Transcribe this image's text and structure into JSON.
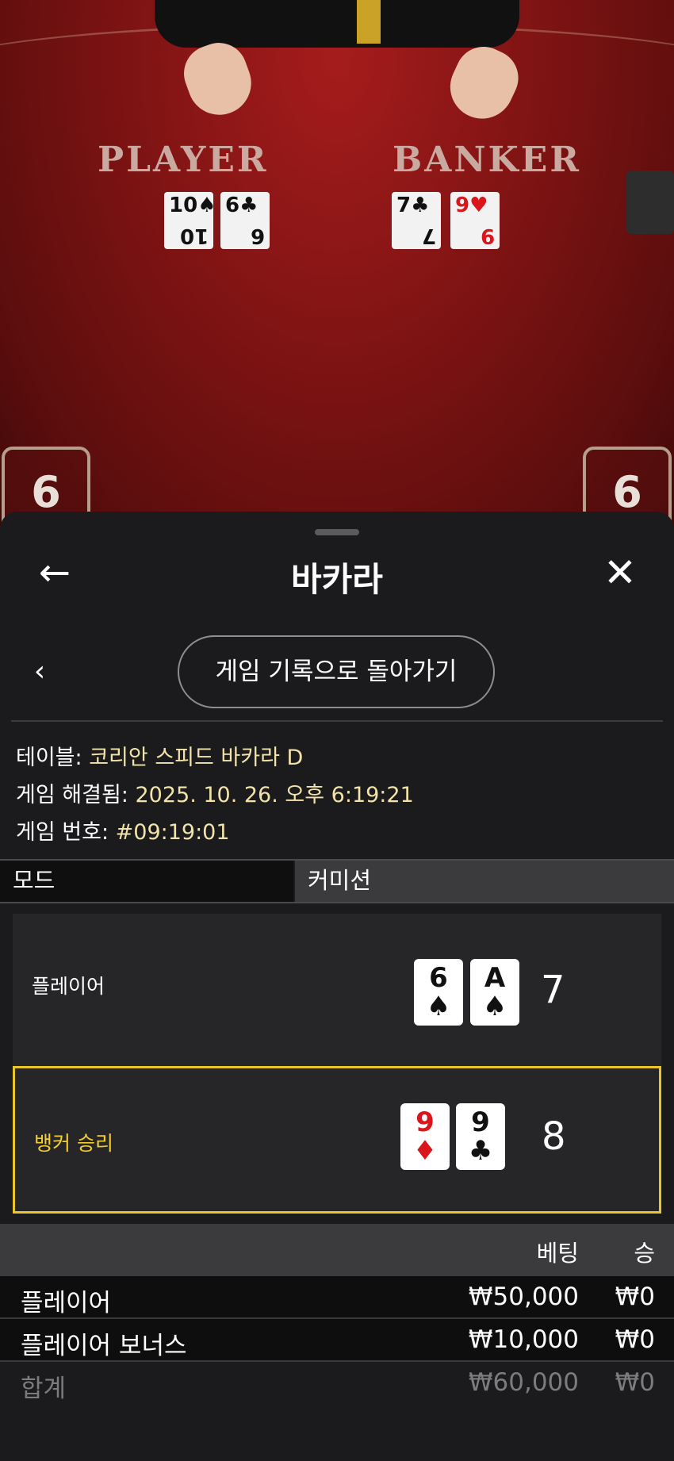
{
  "video": {
    "player_label": "PLAYER",
    "banker_label": "BANKER",
    "player_cards": [
      {
        "rank": "10",
        "suit": "♠",
        "color": "#111111"
      },
      {
        "rank": "6",
        "suit": "♣",
        "color": "#111111"
      }
    ],
    "banker_cards": [
      {
        "rank": "7",
        "suit": "♣",
        "color": "#111111"
      },
      {
        "rank": "9",
        "suit": "♥",
        "color": "#d8161b"
      }
    ],
    "player_score": "6",
    "banker_score": "6"
  },
  "header": {
    "back_icon": "←",
    "title": "바카라",
    "close_icon": "✕"
  },
  "nav": {
    "back_icon": "‹",
    "back_to_history": "게임 기록으로 돌아가기"
  },
  "info": {
    "table_label": "테이블:",
    "table_value": "코리안 스피드 바카라 D",
    "resolved_label": "게임 해결됨:",
    "resolved_value": "2025. 10. 26. 오후 6:19:21",
    "game_no_label": "게임 번호:",
    "game_no_value": "#09:19:01"
  },
  "tabs": {
    "mode": "모드",
    "commission": "커미션"
  },
  "result": {
    "player": {
      "label": "플레이어",
      "cards": [
        {
          "rank": "6",
          "suit": "♠"
        },
        {
          "rank": "A",
          "suit": "♠"
        }
      ],
      "total": "7"
    },
    "banker": {
      "label": "뱅커 승리",
      "cards": [
        {
          "rank": "9",
          "suit": "♦"
        },
        {
          "rank": "9",
          "suit": "♣"
        }
      ],
      "total": "8"
    },
    "highlight_color": "#e9c62a"
  },
  "bets": {
    "col_bet": "베팅",
    "col_win": "승",
    "rows": [
      {
        "name": "플레이어",
        "bet": "₩50,000",
        "win": "₩0"
      },
      {
        "name": "플레이어 보너스",
        "bet": "₩10,000",
        "win": "₩0"
      }
    ],
    "total": {
      "name": "합계",
      "bet": "₩60,000",
      "win": "₩0"
    }
  }
}
